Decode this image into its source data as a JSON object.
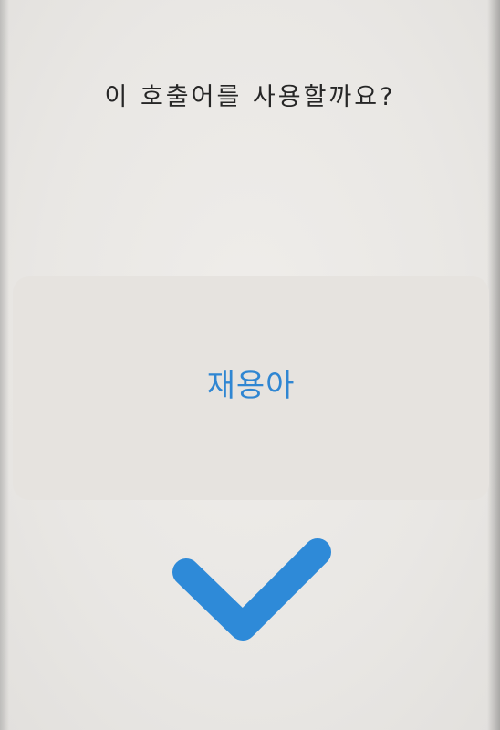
{
  "dialog": {
    "question": "이 호출어를 사용할까요?",
    "choice_label": "재용아"
  },
  "confirm": {
    "icon": "check-icon",
    "color": "#2e8ad8"
  },
  "colors": {
    "background": "#ebe9e6",
    "accent": "#2f86d2",
    "text": "#262626"
  }
}
